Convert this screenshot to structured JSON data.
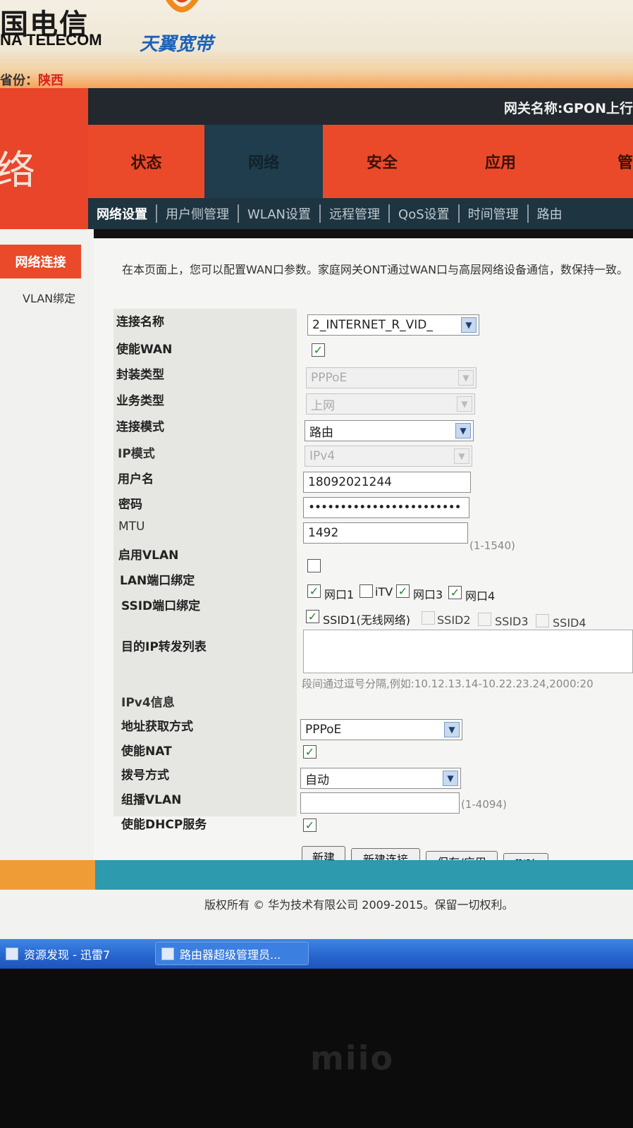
{
  "banner": {
    "telecom_cn": "国电信",
    "telecom_en": "NA TELECOM",
    "broadband": "天翼宽带",
    "province_label": "省份：",
    "province_value": "陕西"
  },
  "header": {
    "gateway_name": "网关名称:GPON上行",
    "left_glyph": "络"
  },
  "tabs": [
    "状态",
    "网络",
    "安全",
    "应用",
    "管"
  ],
  "subnav": [
    "网络设置",
    "用户侧管理",
    "WLAN设置",
    "远程管理",
    "QoS设置",
    "时间管理",
    "路由"
  ],
  "sidebar": {
    "active": "网络连接",
    "item": "VLAN绑定"
  },
  "intro": "在本页面上，您可以配置WAN口参数。家庭网关ONT通过WAN口与高层网络设备通信，数保持一致。",
  "form": {
    "connection_name_label": "连接名称",
    "connection_name_value": "2_INTERNET_R_VID_",
    "enable_wan_label": "使能WAN",
    "encap_label": "封装类型",
    "encap_value": "PPPoE",
    "service_label": "业务类型",
    "service_value": "上网",
    "mode_label": "连接模式",
    "mode_value": "路由",
    "ipmode_label": "IP模式",
    "ipmode_value": "IPv4",
    "username_label": "用户名",
    "username_value": "18092021244",
    "password_label": "密码",
    "password_value": "••••••••••••••••••••••••",
    "mtu_label": "MTU",
    "mtu_value": "1492",
    "mtu_hint": "(1-1540)",
    "vlan_label": "启用VLAN",
    "lan_bind_label": "LAN端口绑定",
    "lan_ports": [
      "网口1",
      "iTV",
      "网口3",
      "网口4"
    ],
    "ssid_bind_label": "SSID端口绑定",
    "ssids": [
      "SSID1(无线网络)",
      "SSID2",
      "SSID3",
      "SSID4"
    ],
    "dest_ip_label": "目的IP转发列表",
    "dest_ip_hint": "段间通过逗号分隔,例如:10.12.13.14-10.22.23.24,2000:20",
    "ipv4_info_label": "IPv4信息",
    "addr_method_label": "地址获取方式",
    "addr_method_value": "PPPoE",
    "nat_label": "使能NAT",
    "dial_label": "拨号方式",
    "dial_value": "自动",
    "mcast_label": "组播VLAN",
    "mcast_hint": "(1-4094)",
    "dhcp_label": "使能DHCP服务"
  },
  "buttons": {
    "new": "新建",
    "new_connection": "新建连接",
    "save_apply": "保存/应用",
    "delete": "删除"
  },
  "footer": {
    "copyright": "版权所有 © 华为技术有限公司 2009-2015。保留一切权利。"
  },
  "taskbar": {
    "item1": "资源发现 - 迅雷7",
    "item2": "路由器超级管理员..."
  },
  "bezel": {
    "brand": "miio"
  }
}
